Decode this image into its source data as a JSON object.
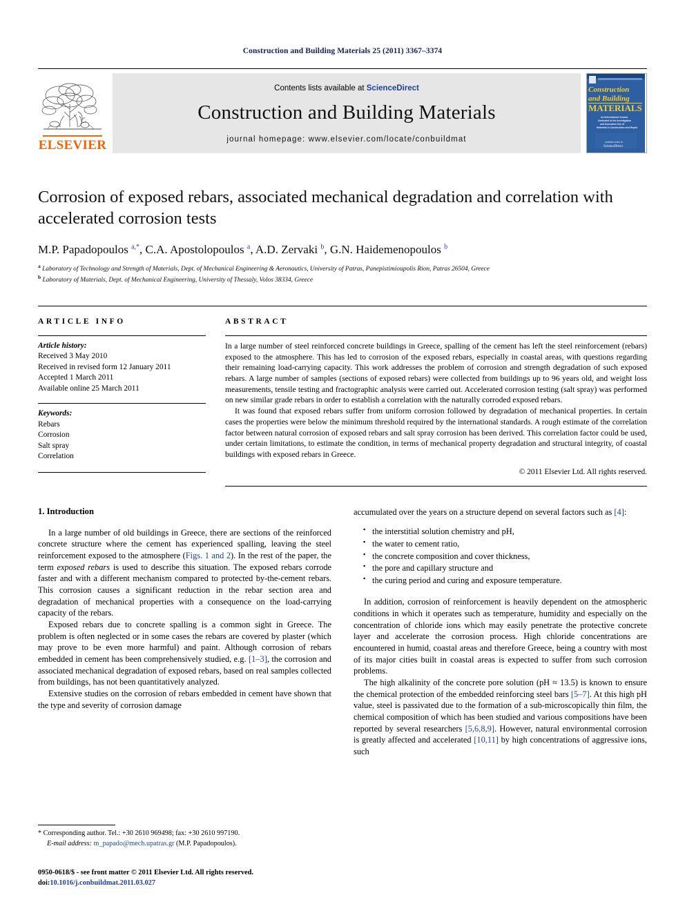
{
  "running_head": "Construction and Building Materials 25 (2011) 3367–3374",
  "masthead": {
    "contents_prefix": "Contents lists available at ",
    "sciencedirect": "ScienceDirect",
    "journal_name": "Construction and Building Materials",
    "homepage": "journal homepage: www.elsevier.com/locate/conbuildmat",
    "publisher_logo_text": "ELSEVIER",
    "cover": {
      "line1": "Construction",
      "line2": "and Building",
      "line3": "MATERIALS",
      "subtitle": "An International Journal Dedicated to the Investigation and Innovative Use of Materials in Construction and Repair",
      "footer_text": "ScienceDirect",
      "bg_color": "#2e5fa3",
      "text_color": "#f5d020"
    }
  },
  "article": {
    "title": "Corrosion of exposed rebars, associated mechanical degradation and correlation with accelerated corrosion tests",
    "authors_html": "M.P. Papadopoulos <sup>a,*</sup>, C.A. Apostolopoulos <sup>a</sup>, A.D. Zervaki <sup>b</sup>, G.N. Haidemenopoulos <sup>b</sup>",
    "affiliation_a": "Laboratory of Technology and Strength of Materials, Dept. of Mechanical Engineering & Aeronautics, University of Patras, Panepistimioupolis Rion, Patras 26504, Greece",
    "affiliation_b": "Laboratory of Materials, Dept. of Mechanical Engineering, University of Thessaly, Volos 38334, Greece"
  },
  "info": {
    "heading": "ARTICLE INFO",
    "history_label": "Article history:",
    "history": [
      "Received 3 May 2010",
      "Received in revised form 12 January 2011",
      "Accepted 1 March 2011",
      "Available online 25 March 2011"
    ],
    "keywords_label": "Keywords:",
    "keywords": [
      "Rebars",
      "Corrosion",
      "Salt spray",
      "Correlation"
    ]
  },
  "abstract": {
    "heading": "ABSTRACT",
    "paragraph1": "In a large number of steel reinforced concrete buildings in Greece, spalling of the cement has left the steel reinforcement (rebars) exposed to the atmosphere. This has led to corrosion of the exposed rebars, especially in coastal areas, with questions regarding their remaining load-carrying capacity. This work addresses the problem of corrosion and strength degradation of such exposed rebars. A large number of samples (sections of exposed rebars) were collected from buildings up to 96 years old, and weight loss measurements, tensile testing and fractographic analysis were carried out. Accelerated corrosion testing (salt spray) was performed on new similar grade rebars in order to establish a correlation with the naturally corroded exposed rebars.",
    "paragraph2": "It was found that exposed rebars suffer from uniform corrosion followed by degradation of mechanical properties. In certain cases the properties were below the minimum threshold required by the international standards. A rough estimate of the correlation factor between natural corrosion of exposed rebars and salt spray corrosion has been derived. This correlation factor could be used, under certain limitations, to estimate the condition, in terms of mechanical property degradation and structural integrity, of coastal buildings with exposed rebars in Greece.",
    "copyright": "© 2011 Elsevier Ltd. All rights reserved."
  },
  "body": {
    "section_heading": "1. Introduction",
    "left": {
      "p1_a": "In a large number of old buildings in Greece, there are sections of the reinforced concrete structure where the cement has experienced spalling, leaving the steel reinforcement exposed to the atmosphere (",
      "p1_link": "Figs. 1 and 2",
      "p1_b": "). In the rest of the paper, the term ",
      "p1_italic": "exposed rebars",
      "p1_c": " is used to describe this situation. The exposed rebars corrode faster and with a different mechanism compared to protected by-the-cement rebars. This corrosion causes a significant reduction in the rebar section area and degradation of mechanical properties with a consequence on the load-carrying capacity of the rebars.",
      "p2_a": "Exposed rebars due to concrete spalling is a common sight in Greece. The problem is often neglected or in some cases the rebars are covered by plaster (which may prove to be even more harmful) and paint. Although corrosion of rebars embedded in cement has been comprehensively studied, e.g. ",
      "p2_link": "[1–3]",
      "p2_b": ", the corrosion and associated mechanical degradation of exposed rebars, based on real samples collected from buildings, has not been quantitatively analyzed.",
      "p3": "Extensive studies on the corrosion of rebars embedded in cement have shown that the type and severity of corrosion damage"
    },
    "right": {
      "p1_a": "accumulated over the years on a structure depend on several factors such as ",
      "p1_link": "[4]",
      "p1_b": ":",
      "factors": [
        "the interstitial solution chemistry and pH,",
        "the water to cement ratio,",
        "the concrete composition and cover thickness,",
        "the pore and capillary structure and",
        "the curing period and curing and exposure temperature."
      ],
      "p2": "In addition, corrosion of reinforcement is heavily dependent on the atmospheric conditions in which it operates such as temperature, humidity and especially on the concentration of chloride ions which may easily penetrate the protective concrete layer and accelerate the corrosion process. High chloride concentrations are encountered in humid, coastal areas and therefore Greece, being a country with most of its major cities built in coastal areas is expected to suffer from such corrosion problems.",
      "p3_a": "The high alkalinity of the concrete pore solution (pH ≈ 13.5) is known to ensure the chemical protection of the embedded reinforcing steel bars ",
      "p3_link1": "[5–7]",
      "p3_b": ". At this high pH value, steel is passivated due to the formation of a sub-microscopically thin film, the chemical composition of which has been studied and various compositions have been reported by several researchers ",
      "p3_link2": "[5,6,8,9]",
      "p3_c": ". However, natural environmental corrosion is greatly affected and accelerated ",
      "p3_link3": "[10,11]",
      "p3_d": " by high concentrations of aggressive ions, such"
    }
  },
  "footnote": {
    "marker": "*",
    "line1": "Corresponding author. Tel.: +30 2610 969498; fax: +30 2610 997190.",
    "email_label": "E-mail address:",
    "email": "m_papado@mech.upatras.gr",
    "email_owner": "(M.P. Papadopoulos)."
  },
  "footer": {
    "issn_line": "0950-0618/$ - see front matter © 2011 Elsevier Ltd. All rights reserved.",
    "doi_label": "doi:",
    "doi_value": "10.1016/j.conbuildmat.2011.03.027"
  },
  "colors": {
    "link_blue": "#1d3fa0",
    "elsevier_orange": "#ec6608",
    "masthead_gray": "#e6e6e6",
    "running_head_navy": "#14205e"
  }
}
